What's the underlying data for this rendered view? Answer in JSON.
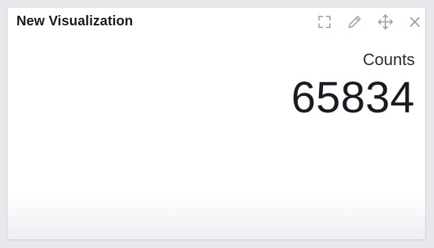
{
  "panel": {
    "title": "New Visualization",
    "actions": [
      {
        "icon": "fullscreen-icon",
        "label": "Full screen"
      },
      {
        "icon": "pencil-icon",
        "label": "Edit"
      },
      {
        "icon": "move-icon",
        "label": "Move"
      },
      {
        "icon": "close-icon",
        "label": "Close"
      }
    ]
  },
  "metric": {
    "label": "Counts",
    "value": "65834"
  },
  "colors": {
    "icon": "#98a2b3",
    "text": "#1a1c21",
    "border": "#d5d9e0",
    "background": "#ffffff"
  }
}
